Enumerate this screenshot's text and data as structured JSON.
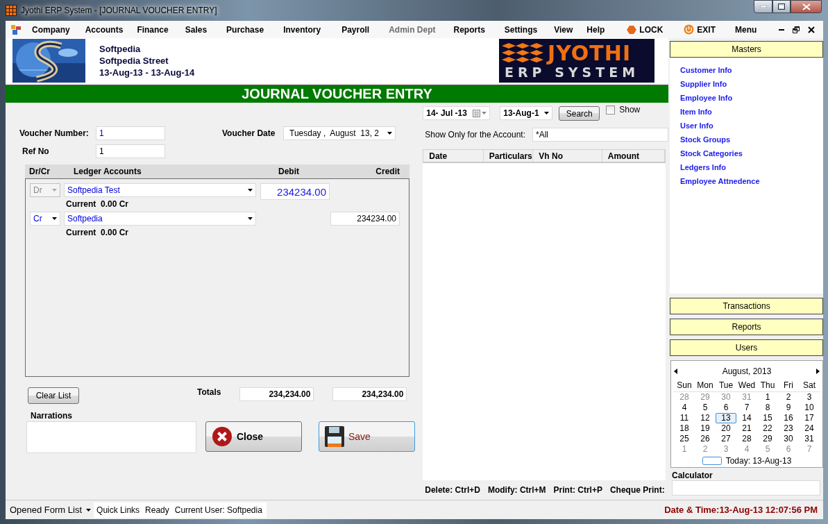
{
  "window": {
    "title": "Jyothi ERP System - [JOURNAL VOUCHER ENTRY]"
  },
  "menu": {
    "items": [
      {
        "label": "Company",
        "disabled": false
      },
      {
        "label": "Accounts",
        "disabled": false
      },
      {
        "label": "Finance",
        "disabled": false
      },
      {
        "label": "Sales",
        "disabled": false
      },
      {
        "label": "Purchase",
        "disabled": false
      },
      {
        "label": "Inventory",
        "disabled": false
      },
      {
        "label": "Payroll",
        "disabled": false
      },
      {
        "label": "Admin Dept",
        "disabled": true
      },
      {
        "label": "Reports",
        "disabled": false
      },
      {
        "label": "Settings",
        "disabled": false
      },
      {
        "label": "View",
        "disabled": false
      },
      {
        "label": "Help",
        "disabled": false
      }
    ],
    "lock": "LOCK",
    "exit": "EXIT",
    "menu": "Menu"
  },
  "company": {
    "name": "Softpedia",
    "street": "Softpedia Street",
    "period": "13-Aug-13 - 13-Aug-14"
  },
  "brand": {
    "title": "JYOTHI",
    "subtitle": "ERP SYSTEM"
  },
  "form": {
    "title": "JOURNAL VOUCHER ENTRY",
    "voucher_number_label": "Voucher Number:",
    "voucher_number": "1",
    "voucher_date_label": "Voucher Date",
    "voucher_date": "Tuesday ,  August  13, 2",
    "ref_no_label": "Ref No",
    "ref_no": "1",
    "columns": [
      "Dr/Cr",
      "Ledger Accounts",
      "Debit",
      "Credit"
    ],
    "entries": [
      {
        "side": "Dr",
        "side_disabled": true,
        "account": "Softpedia Test",
        "balance": "Current  0.00 Cr",
        "debit": "234234.00"
      },
      {
        "side": "Cr",
        "side_disabled": false,
        "account": "Softpedia",
        "balance": "Current  0.00 Cr",
        "credit": "234234.00"
      }
    ],
    "clear_button": "Clear List",
    "totals_label": "Totals",
    "total_debit": "234,234.00",
    "total_credit": "234,234.00",
    "narrations_label": "Narrations",
    "close_button": "Close",
    "save_button": "Save"
  },
  "history": {
    "from_date": "14- Jul -13",
    "to_date": "13-Aug-1",
    "search_button": "Search",
    "show": {
      "label": "Show",
      "checked": false
    },
    "account_label": "Show Only for the Account:",
    "account": "*All",
    "columns": [
      "Date",
      "Particulars",
      "Vh No",
      "Amount"
    ],
    "shortcuts": [
      "Delete: Ctrl+D",
      "Modify: Ctrl+M",
      "Print: Ctrl+P",
      "Cheque Print:"
    ]
  },
  "sidebar": {
    "sections": [
      {
        "title": "Masters",
        "expanded": true,
        "links": [
          "Customer Info",
          "Supplier Info",
          "Employee Info",
          "Item Info",
          "User Info",
          "Stock Groups",
          "Stock Categories",
          "Ledgers Info",
          "Employee Attnedence"
        ]
      },
      {
        "title": "Transactions",
        "expanded": false
      },
      {
        "title": "Reports",
        "expanded": false
      },
      {
        "title": "Users",
        "expanded": false
      }
    ]
  },
  "calendar": {
    "title": "August, 2013",
    "weekdays": [
      "Sun",
      "Mon",
      "Tue",
      "Wed",
      "Thu",
      "Fri",
      "Sat"
    ],
    "weeks": [
      [
        {
          "label": "28",
          "other_month": true,
          "selected": false
        },
        {
          "label": "29",
          "other_month": true,
          "selected": false
        },
        {
          "label": "30",
          "other_month": true,
          "selected": false
        },
        {
          "label": "31",
          "other_month": true,
          "selected": false
        },
        {
          "label": "1",
          "other_month": false,
          "selected": false
        },
        {
          "label": "2",
          "other_month": false,
          "selected": false
        },
        {
          "label": "3",
          "other_month": false,
          "selected": false
        }
      ],
      [
        {
          "label": "4",
          "other_month": false,
          "selected": false
        },
        {
          "label": "5",
          "other_month": false,
          "selected": false
        },
        {
          "label": "6",
          "other_month": false,
          "selected": false
        },
        {
          "label": "7",
          "other_month": false,
          "selected": false
        },
        {
          "label": "8",
          "other_month": false,
          "selected": false
        },
        {
          "label": "9",
          "other_month": false,
          "selected": false
        },
        {
          "label": "10",
          "other_month": false,
          "selected": false
        }
      ],
      [
        {
          "label": "11",
          "other_month": false,
          "selected": false
        },
        {
          "label": "12",
          "other_month": false,
          "selected": false
        },
        {
          "label": "13",
          "other_month": false,
          "selected": true
        },
        {
          "label": "14",
          "other_month": false,
          "selected": false
        },
        {
          "label": "15",
          "other_month": false,
          "selected": false
        },
        {
          "label": "16",
          "other_month": false,
          "selected": false
        },
        {
          "label": "17",
          "other_month": false,
          "selected": false
        }
      ],
      [
        {
          "label": "18",
          "other_month": false,
          "selected": false
        },
        {
          "label": "19",
          "other_month": false,
          "selected": false
        },
        {
          "label": "20",
          "other_month": false,
          "selected": false
        },
        {
          "label": "21",
          "other_month": false,
          "selected": false
        },
        {
          "label": "22",
          "other_month": false,
          "selected": false
        },
        {
          "label": "23",
          "other_month": false,
          "selected": false
        },
        {
          "label": "24",
          "other_month": false,
          "selected": false
        }
      ],
      [
        {
          "label": "25",
          "other_month": false,
          "selected": false
        },
        {
          "label": "26",
          "other_month": false,
          "selected": false
        },
        {
          "label": "27",
          "other_month": false,
          "selected": false
        },
        {
          "label": "28",
          "other_month": false,
          "selected": false
        },
        {
          "label": "29",
          "other_month": false,
          "selected": false
        },
        {
          "label": "30",
          "other_month": false,
          "selected": false
        },
        {
          "label": "31",
          "other_month": false,
          "selected": false
        }
      ],
      [
        {
          "label": "1",
          "other_month": true,
          "selected": false
        },
        {
          "label": "2",
          "other_month": true,
          "selected": false
        },
        {
          "label": "3",
          "other_month": true,
          "selected": false
        },
        {
          "label": "4",
          "other_month": true,
          "selected": false
        },
        {
          "label": "5",
          "other_month": true,
          "selected": false
        },
        {
          "label": "6",
          "other_month": true,
          "selected": false
        },
        {
          "label": "7",
          "other_month": true,
          "selected": false
        }
      ]
    ],
    "today": "Today: 13-Aug-13"
  },
  "calculator": {
    "label": "Calculator"
  },
  "status_bar": {
    "forms": "Opened Form List",
    "quick_links": "Quick Links",
    "status": "Ready",
    "user": "Current User: Softpedia",
    "clock": "Date & Time:13-Aug-13 12:07:56 PM"
  }
}
